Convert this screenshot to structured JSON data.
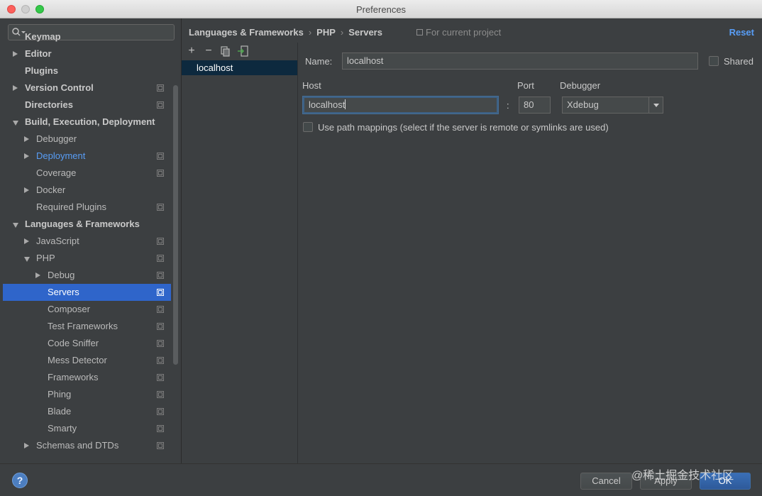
{
  "window": {
    "title": "Preferences"
  },
  "search": {
    "placeholder": ""
  },
  "sidebar": {
    "items": [
      {
        "label": "Keymap",
        "level": 0,
        "bold": true,
        "arrow": "none"
      },
      {
        "label": "Editor",
        "level": 0,
        "bold": true,
        "arrow": "right"
      },
      {
        "label": "Plugins",
        "level": 0,
        "bold": true,
        "arrow": "none"
      },
      {
        "label": "Version Control",
        "level": 0,
        "bold": true,
        "arrow": "right",
        "project": true
      },
      {
        "label": "Directories",
        "level": 0,
        "bold": true,
        "arrow": "none",
        "project": true
      },
      {
        "label": "Build, Execution, Deployment",
        "level": 0,
        "bold": true,
        "arrow": "down"
      },
      {
        "label": "Debugger",
        "level": 1,
        "arrow": "right"
      },
      {
        "label": "Deployment",
        "level": 1,
        "arrow": "right",
        "link": true,
        "project": true
      },
      {
        "label": "Coverage",
        "level": 1,
        "arrow": "none",
        "project": true
      },
      {
        "label": "Docker",
        "level": 1,
        "arrow": "right"
      },
      {
        "label": "Required Plugins",
        "level": 1,
        "arrow": "none",
        "project": true
      },
      {
        "label": "Languages & Frameworks",
        "level": 0,
        "bold": true,
        "arrow": "down"
      },
      {
        "label": "JavaScript",
        "level": 1,
        "arrow": "right",
        "project": true
      },
      {
        "label": "PHP",
        "level": 1,
        "arrow": "down",
        "project": true
      },
      {
        "label": "Debug",
        "level": 2,
        "arrow": "right",
        "project": true
      },
      {
        "label": "Servers",
        "level": 2,
        "arrow": "none",
        "selected": true,
        "project": true
      },
      {
        "label": "Composer",
        "level": 2,
        "arrow": "none",
        "project": true
      },
      {
        "label": "Test Frameworks",
        "level": 2,
        "arrow": "none",
        "project": true
      },
      {
        "label": "Code Sniffer",
        "level": 2,
        "arrow": "none",
        "project": true
      },
      {
        "label": "Mess Detector",
        "level": 2,
        "arrow": "none",
        "project": true
      },
      {
        "label": "Frameworks",
        "level": 2,
        "arrow": "none",
        "project": true
      },
      {
        "label": "Phing",
        "level": 2,
        "arrow": "none",
        "project": true
      },
      {
        "label": "Blade",
        "level": 2,
        "arrow": "none",
        "project": true
      },
      {
        "label": "Smarty",
        "level": 2,
        "arrow": "none",
        "project": true
      },
      {
        "label": "Schemas and DTDs",
        "level": 1,
        "arrow": "right",
        "project": true
      }
    ]
  },
  "breadcrumb": {
    "parts": [
      "Languages & Frameworks",
      "PHP",
      "Servers"
    ],
    "scope": "For current project",
    "reset": "Reset"
  },
  "servers": {
    "toolbar": {
      "add": "+",
      "remove": "−"
    },
    "items": [
      "localhost"
    ]
  },
  "form": {
    "name_label": "Name:",
    "name_value": "localhost",
    "shared_label": "Shared",
    "host_label": "Host",
    "host_value": "localhost",
    "port_label": "Port",
    "port_value": "80",
    "colon": ":",
    "debugger_label": "Debugger",
    "debugger_value": "Xdebug",
    "path_mappings_label": "Use path mappings (select if the server is remote or symlinks are used)"
  },
  "footer": {
    "help": "?",
    "cancel": "Cancel",
    "apply": "Apply",
    "ok": "OK",
    "watermark": "@稀土掘金技术社区"
  },
  "colors": {
    "accent": "#2f65ca",
    "link": "#589df6",
    "background": "#3c3f41"
  }
}
